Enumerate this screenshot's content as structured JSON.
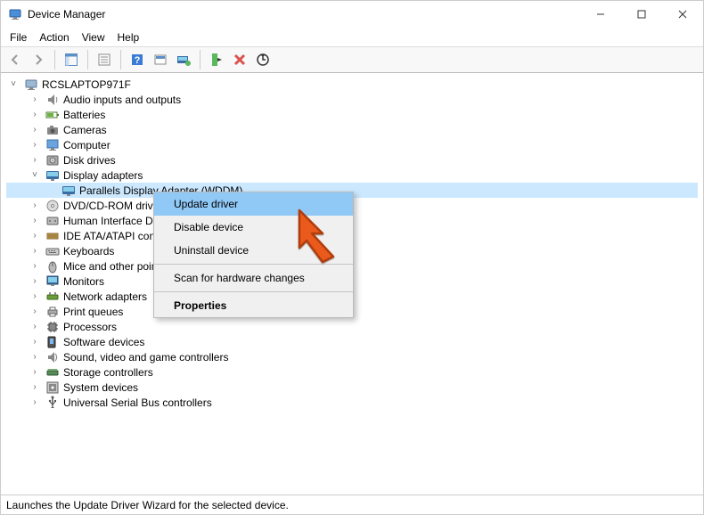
{
  "titlebar": {
    "title": "Device Manager"
  },
  "menubar": [
    "File",
    "Action",
    "View",
    "Help"
  ],
  "tree": {
    "root": "RCSLAPTOP971F",
    "nodes": [
      {
        "label": "Audio inputs and outputs",
        "icon": "audio",
        "expanded": false,
        "depth": 1
      },
      {
        "label": "Batteries",
        "icon": "battery",
        "expanded": false,
        "depth": 1
      },
      {
        "label": "Cameras",
        "icon": "camera",
        "expanded": false,
        "depth": 1
      },
      {
        "label": "Computer",
        "icon": "computer",
        "expanded": false,
        "depth": 1
      },
      {
        "label": "Disk drives",
        "icon": "disk",
        "expanded": false,
        "depth": 1
      },
      {
        "label": "Display adapters",
        "icon": "display",
        "expanded": true,
        "depth": 1
      },
      {
        "label": "Parallels Display Adapter (WDDM)",
        "icon": "display",
        "expanded": false,
        "depth": 2,
        "selected": true
      },
      {
        "label": "DVD/CD-ROM drives",
        "icon": "dvd",
        "expanded": false,
        "depth": 1,
        "trunc": true
      },
      {
        "label": "Human Interface Devices",
        "icon": "hid",
        "expanded": false,
        "depth": 1,
        "trunc": true
      },
      {
        "label": "IDE ATA/ATAPI controllers",
        "icon": "ide",
        "expanded": false,
        "depth": 1,
        "trunc": true
      },
      {
        "label": "Keyboards",
        "icon": "keyboard",
        "expanded": false,
        "depth": 1
      },
      {
        "label": "Mice and other pointing devices",
        "icon": "mouse",
        "expanded": false,
        "depth": 1,
        "trunc": true
      },
      {
        "label": "Monitors",
        "icon": "monitor",
        "expanded": false,
        "depth": 1
      },
      {
        "label": "Network adapters",
        "icon": "network",
        "expanded": false,
        "depth": 1
      },
      {
        "label": "Print queues",
        "icon": "printer",
        "expanded": false,
        "depth": 1
      },
      {
        "label": "Processors",
        "icon": "cpu",
        "expanded": false,
        "depth": 1
      },
      {
        "label": "Software devices",
        "icon": "software",
        "expanded": false,
        "depth": 1
      },
      {
        "label": "Sound, video and game controllers",
        "icon": "sound",
        "expanded": false,
        "depth": 1
      },
      {
        "label": "Storage controllers",
        "icon": "storage",
        "expanded": false,
        "depth": 1
      },
      {
        "label": "System devices",
        "icon": "system",
        "expanded": false,
        "depth": 1
      },
      {
        "label": "Universal Serial Bus controllers",
        "icon": "usb",
        "expanded": false,
        "depth": 1
      }
    ]
  },
  "context_menu": {
    "items": [
      {
        "label": "Update driver",
        "highlight": true
      },
      {
        "label": "Disable device"
      },
      {
        "label": "Uninstall device"
      },
      {
        "sep": true
      },
      {
        "label": "Scan for hardware changes"
      },
      {
        "sep": true
      },
      {
        "label": "Properties",
        "bold": true
      }
    ]
  },
  "statusbar": "Launches the Update Driver Wizard for the selected device."
}
